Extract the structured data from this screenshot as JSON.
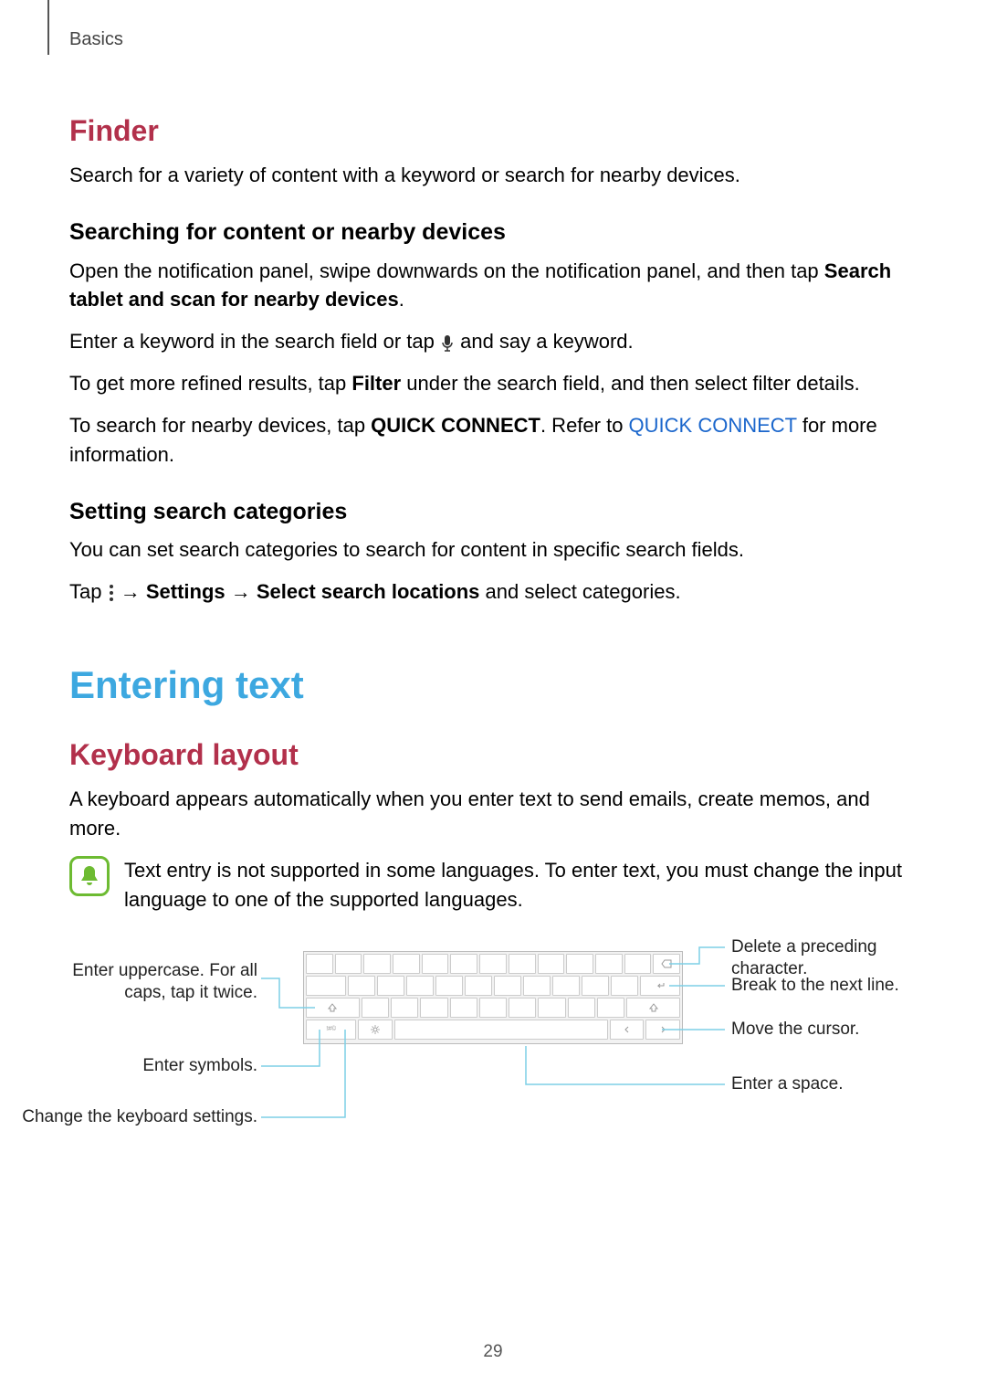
{
  "header": {
    "breadcrumb": "Basics"
  },
  "finder": {
    "heading": "Finder",
    "intro": "Search for a variety of content with a keyword or search for nearby devices.",
    "sub1_heading": "Searching for content or nearby devices",
    "sub1_p1_a": "Open the notification panel, swipe downwards on the notification panel, and then tap ",
    "sub1_p1_b": "Search tablet and scan for nearby devices",
    "sub1_p1_c": ".",
    "sub1_p2_a": "Enter a keyword in the search field or tap ",
    "sub1_p2_b": " and say a keyword.",
    "sub1_p3_a": "To get more refined results, tap ",
    "sub1_p3_b": "Filter",
    "sub1_p3_c": " under the search field, and then select filter details.",
    "sub1_p4_a": "To search for nearby devices, tap ",
    "sub1_p4_b": "QUICK CONNECT",
    "sub1_p4_c": ". Refer to ",
    "sub1_p4_link": "QUICK CONNECT",
    "sub1_p4_d": " for more information.",
    "sub2_heading": "Setting search categories",
    "sub2_p1": "You can set search categories to search for content in specific search fields.",
    "sub2_p2_a": "Tap ",
    "sub2_p2_b": " → ",
    "sub2_p2_c": "Settings",
    "sub2_p2_d": " → ",
    "sub2_p2_e": "Select search locations",
    "sub2_p2_f": " and select categories."
  },
  "entering": {
    "heading": "Entering text",
    "sub_heading": "Keyboard layout",
    "p1": "A keyboard appears automatically when you enter text to send emails, create memos, and more.",
    "note": "Text entry is not supported in some languages. To enter text, you must change the input language to one of the supported languages."
  },
  "callouts": {
    "left1": "Enter uppercase. For all caps, tap it twice.",
    "left2": "Enter symbols.",
    "left3": "Change the keyboard settings.",
    "right1": "Delete a preceding character.",
    "right2": "Break to the next line.",
    "right3": "Move the cursor.",
    "right4": "Enter a space."
  },
  "page": "29"
}
